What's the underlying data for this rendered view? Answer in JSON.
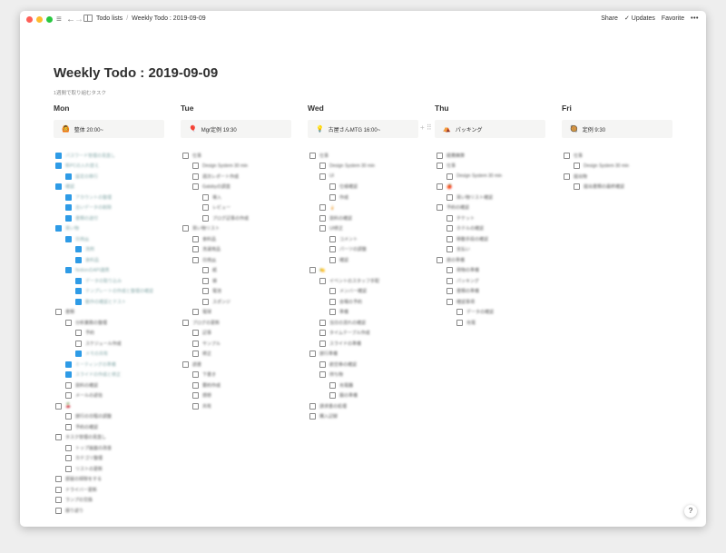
{
  "topbar": {
    "breadcrumb_parent": "Todo lists",
    "breadcrumb_current": "Weekly Todo : 2019-09-09",
    "share_label": "Share",
    "updates_label": "Updates",
    "favorite_label": "Favorite",
    "more_label": "•••"
  },
  "page": {
    "title": "Weekly Todo : 2019-09-09",
    "subtitle": "1週間で取り組むタスク"
  },
  "days": [
    {
      "label": "Mon",
      "callout_emoji": "🙆",
      "callout_text": "整体 20:00~"
    },
    {
      "label": "Tue",
      "callout_emoji": "🎈",
      "callout_text": "Mgr定例 19:30"
    },
    {
      "label": "Wed",
      "callout_emoji": "💡",
      "callout_text": "古屋さんMTG 16:00~"
    },
    {
      "label": "Thu",
      "callout_emoji": "⛺",
      "callout_text": "パッキング"
    },
    {
      "label": "Fri",
      "callout_emoji": "🥘",
      "callout_text": "定例 9:30"
    }
  ],
  "columns": [
    [
      {
        "i": 0,
        "c": true,
        "t": "パスワード管理の見直し"
      },
      {
        "i": 0,
        "c": true,
        "t": "新PCの入れ替え"
      },
      {
        "i": 1,
        "c": true,
        "t": "設定の移行"
      },
      {
        "i": 0,
        "c": true,
        "t": "確認"
      },
      {
        "i": 1,
        "c": true,
        "t": "アカウントの整理"
      },
      {
        "i": 1,
        "c": true,
        "t": "古いデータの削除"
      },
      {
        "i": 1,
        "c": true,
        "t": "書類の送付"
      },
      {
        "i": 0,
        "c": true,
        "t": "買い物"
      },
      {
        "i": 1,
        "c": true,
        "t": "日用品"
      },
      {
        "i": 2,
        "c": true,
        "t": "洗剤"
      },
      {
        "i": 2,
        "c": true,
        "t": "食料品"
      },
      {
        "i": 1,
        "c": true,
        "t": "NotionのAPI連携"
      },
      {
        "i": 2,
        "c": true,
        "t": "データの取り込み"
      },
      {
        "i": 2,
        "c": true,
        "t": "テンプレートの作成と整理の確認"
      },
      {
        "i": 2,
        "c": true,
        "t": "動作の確認とテスト"
      },
      {
        "i": 0,
        "c": false,
        "t": "書類"
      },
      {
        "i": 1,
        "c": false,
        "t": "分析業務の整理"
      },
      {
        "i": 2,
        "c": false,
        "t": "予約"
      },
      {
        "i": 2,
        "c": false,
        "t": "スケジュール作成"
      },
      {
        "i": 2,
        "c": true,
        "t": "メモの共有"
      },
      {
        "i": 1,
        "c": true,
        "t": "ミーティングの準備"
      },
      {
        "i": 1,
        "c": true,
        "t": "スライドの作成と修正"
      },
      {
        "i": 1,
        "c": false,
        "t": "資料の確認"
      },
      {
        "i": 1,
        "c": false,
        "t": "メールの返信"
      },
      {
        "i": 0,
        "c": false,
        "t": "🍒"
      },
      {
        "i": 1,
        "c": false,
        "t": "旅行の日程の調整"
      },
      {
        "i": 1,
        "c": false,
        "t": "予約の確認"
      },
      {
        "i": 0,
        "c": false,
        "t": "タスク管理の見直し"
      },
      {
        "i": 1,
        "c": false,
        "t": "トップ画面の改善"
      },
      {
        "i": 1,
        "c": false,
        "t": "カテゴリ整理"
      },
      {
        "i": 1,
        "c": false,
        "t": "リストの更新"
      },
      {
        "i": 0,
        "c": false,
        "t": "部屋の掃除をする"
      },
      {
        "i": 0,
        "c": false,
        "t": "ドライバー更新"
      },
      {
        "i": 0,
        "c": false,
        "t": "ランプの交換"
      },
      {
        "i": 0,
        "c": false,
        "t": "振り返り"
      }
    ],
    [
      {
        "i": 0,
        "c": false,
        "t": "仕事"
      },
      {
        "i": 1,
        "c": false,
        "t": "Design System 30 min"
      },
      {
        "i": 1,
        "c": false,
        "t": "週次レポート作成"
      },
      {
        "i": 1,
        "c": false,
        "t": "Gatsbyの調査"
      },
      {
        "i": 2,
        "c": false,
        "t": "導入"
      },
      {
        "i": 2,
        "c": false,
        "t": "レビュー"
      },
      {
        "i": 2,
        "c": false,
        "t": "ブログ記事の作成"
      },
      {
        "i": 0,
        "c": false,
        "t": "買い物リスト"
      },
      {
        "i": 1,
        "c": false,
        "t": "食料品"
      },
      {
        "i": 1,
        "c": false,
        "t": "洗濯用品"
      },
      {
        "i": 1,
        "c": false,
        "t": "日用品"
      },
      {
        "i": 2,
        "c": false,
        "t": "紙"
      },
      {
        "i": 2,
        "c": false,
        "t": "袋"
      },
      {
        "i": 2,
        "c": false,
        "t": "電池"
      },
      {
        "i": 2,
        "c": false,
        "t": "スポンジ"
      },
      {
        "i": 1,
        "c": false,
        "t": "電球"
      },
      {
        "i": 0,
        "c": false,
        "t": "ブログの更新"
      },
      {
        "i": 1,
        "c": false,
        "t": "記事"
      },
      {
        "i": 1,
        "c": false,
        "t": "サンプル"
      },
      {
        "i": 1,
        "c": false,
        "t": "修正"
      },
      {
        "i": 0,
        "c": false,
        "t": "読書"
      },
      {
        "i": 1,
        "c": false,
        "t": "下書き"
      },
      {
        "i": 1,
        "c": false,
        "t": "要約作成"
      },
      {
        "i": 1,
        "c": false,
        "t": "感想"
      },
      {
        "i": 1,
        "c": false,
        "t": "共有"
      }
    ],
    [
      {
        "i": 0,
        "c": false,
        "t": "仕事"
      },
      {
        "i": 1,
        "c": false,
        "t": "Design System 30 min"
      },
      {
        "i": 1,
        "c": false,
        "t": "UI"
      },
      {
        "i": 2,
        "c": false,
        "t": "仕様確認"
      },
      {
        "i": 2,
        "c": false,
        "t": "作成"
      },
      {
        "i": 1,
        "c": false,
        "t": "🍦"
      },
      {
        "i": 1,
        "c": false,
        "t": "資料の確認"
      },
      {
        "i": 1,
        "c": false,
        "t": "UI修正"
      },
      {
        "i": 2,
        "c": false,
        "t": "コメント"
      },
      {
        "i": 2,
        "c": false,
        "t": "パーツの調整"
      },
      {
        "i": 2,
        "c": false,
        "t": "確認"
      },
      {
        "i": 0,
        "c": false,
        "t": "🍋"
      },
      {
        "i": 1,
        "c": false,
        "t": "イベントのスタッフ手配"
      },
      {
        "i": 2,
        "c": false,
        "t": "メンバー確認"
      },
      {
        "i": 2,
        "c": false,
        "t": "会場の予約"
      },
      {
        "i": 2,
        "c": false,
        "t": "準備"
      },
      {
        "i": 1,
        "c": false,
        "t": "当日の流れの確認"
      },
      {
        "i": 1,
        "c": false,
        "t": "タイムテーブル作成"
      },
      {
        "i": 1,
        "c": false,
        "t": "スライドの準備"
      },
      {
        "i": 0,
        "c": false,
        "t": "旅行準備"
      },
      {
        "i": 1,
        "c": false,
        "t": "航空券の確認"
      },
      {
        "i": 1,
        "c": false,
        "t": "持ち物"
      },
      {
        "i": 2,
        "c": false,
        "t": "充電器"
      },
      {
        "i": 2,
        "c": false,
        "t": "服の準備"
      },
      {
        "i": 0,
        "c": false,
        "t": "請求書の処理"
      },
      {
        "i": 0,
        "c": false,
        "t": "購入記録"
      }
    ],
    [
      {
        "i": 0,
        "c": false,
        "t": "経費精算"
      },
      {
        "i": 0,
        "c": false,
        "t": "仕事"
      },
      {
        "i": 1,
        "c": false,
        "t": "Design System 30 min"
      },
      {
        "i": 0,
        "c": false,
        "t": "🍎"
      },
      {
        "i": 1,
        "c": false,
        "t": "買い物リスト確認"
      },
      {
        "i": 0,
        "c": false,
        "t": "予約の確認"
      },
      {
        "i": 1,
        "c": false,
        "t": "チケット"
      },
      {
        "i": 1,
        "c": false,
        "t": "ホテルの確認"
      },
      {
        "i": 1,
        "c": false,
        "t": "移動手段の確認"
      },
      {
        "i": 1,
        "c": false,
        "t": "支払い"
      },
      {
        "i": 0,
        "c": false,
        "t": "旅の準備"
      },
      {
        "i": 1,
        "c": false,
        "t": "荷物の準備"
      },
      {
        "i": 1,
        "c": false,
        "t": "パッキング"
      },
      {
        "i": 1,
        "c": false,
        "t": "書類の準備"
      },
      {
        "i": 1,
        "c": false,
        "t": "確認事項"
      },
      {
        "i": 2,
        "c": false,
        "t": "データの確認"
      },
      {
        "i": 2,
        "c": false,
        "t": "充電"
      }
    ],
    [
      {
        "i": 0,
        "c": false,
        "t": "仕事"
      },
      {
        "i": 1,
        "c": false,
        "t": "Design System 30 min"
      },
      {
        "i": 0,
        "c": false,
        "t": "提出物"
      },
      {
        "i": 1,
        "c": false,
        "t": "提出書類の最終確認"
      }
    ]
  ]
}
